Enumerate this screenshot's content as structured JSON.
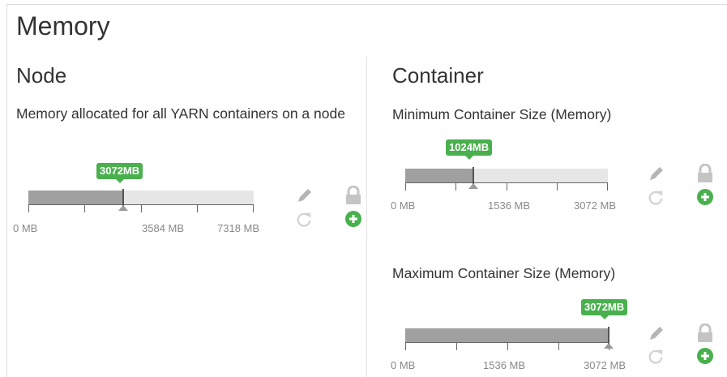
{
  "page": {
    "title": "Memory"
  },
  "node": {
    "title": "Node",
    "description": "Memory allocated for all YARN containers on a node",
    "slider": {
      "value_label": "3072MB",
      "value_mb": 3072,
      "ticks": [
        "0 MB",
        "3584 MB",
        "7318 MB"
      ]
    }
  },
  "container": {
    "title": "Container",
    "min": {
      "label": "Minimum Container Size (Memory)",
      "slider": {
        "value_label": "1024MB",
        "value_mb": 1024,
        "ticks": [
          "0 MB",
          "1536 MB",
          "3072 MB"
        ]
      }
    },
    "max": {
      "label": "Maximum Container Size (Memory)",
      "slider": {
        "value_label": "3072MB",
        "value_mb": 3072,
        "ticks": [
          "0 MB",
          "1536 MB",
          "3072 MB"
        ]
      }
    }
  },
  "icons": {
    "edit": "pencil-icon",
    "undo": "refresh-icon",
    "lock": "lock-icon",
    "add": "plus-circle-icon"
  },
  "colors": {
    "accent_green": "#49b04d",
    "fill_gray": "#a0a0a0",
    "track_gray": "#e6e6e6",
    "icon_gray": "#b5b5b5"
  }
}
